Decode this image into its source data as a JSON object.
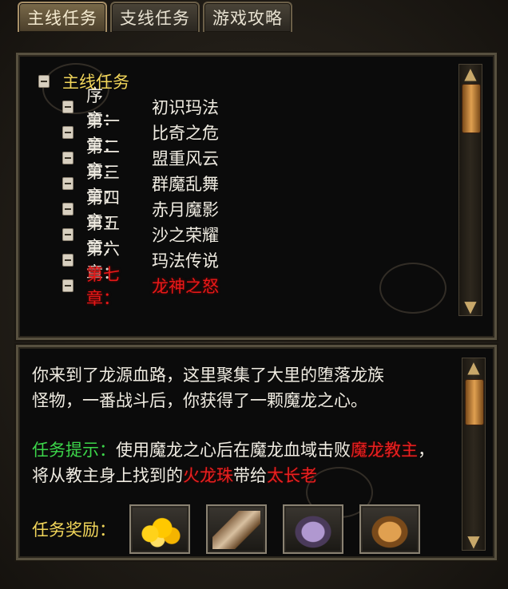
{
  "tabs": [
    {
      "label": "主线任务",
      "active": true
    },
    {
      "label": "支线任务",
      "active": false
    },
    {
      "label": "游戏攻略",
      "active": false
    }
  ],
  "quest_tree": {
    "root_label": "主线任务",
    "chapters": [
      {
        "chapter": "序　章：",
        "title": "初识玛法",
        "state": "normal"
      },
      {
        "chapter": "第一章：",
        "title": "比奇之危",
        "state": "normal"
      },
      {
        "chapter": "第二章：",
        "title": "盟重风云",
        "state": "normal"
      },
      {
        "chapter": "第三章：",
        "title": "群魔乱舞",
        "state": "normal"
      },
      {
        "chapter": "第四章：",
        "title": "赤月魔影",
        "state": "normal"
      },
      {
        "chapter": "第五章：",
        "title": "沙之荣耀",
        "state": "normal"
      },
      {
        "chapter": "第六章：",
        "title": "玛法传说",
        "state": "normal"
      },
      {
        "chapter": "第七章：",
        "title": "龙神之怒",
        "state": "current"
      }
    ]
  },
  "description": {
    "line1": "你来到了龙源血路，这里聚集了大里的堕落龙族",
    "line2": "怪物，一番战斗后，你获得了一颗魔龙之心。"
  },
  "hint": {
    "label": "任务提示：",
    "text1": "使用魔龙之心后在魔龙血域击败",
    "target1": "魔龙教主",
    "text2": "，将从教主身上找到的",
    "item": "火龙珠",
    "text3": "带给",
    "npc": "太长老"
  },
  "reward": {
    "label": "任务奖励：",
    "items": [
      {
        "icon": "gold-coins-icon"
      },
      {
        "icon": "axe-weapon-icon"
      },
      {
        "icon": "wing-armor-icon"
      },
      {
        "icon": "golden-wing-armor-icon"
      }
    ]
  },
  "colors": {
    "hint_label": "#3cd64a",
    "highlight": "#e82020",
    "root": "#f2d65a"
  }
}
